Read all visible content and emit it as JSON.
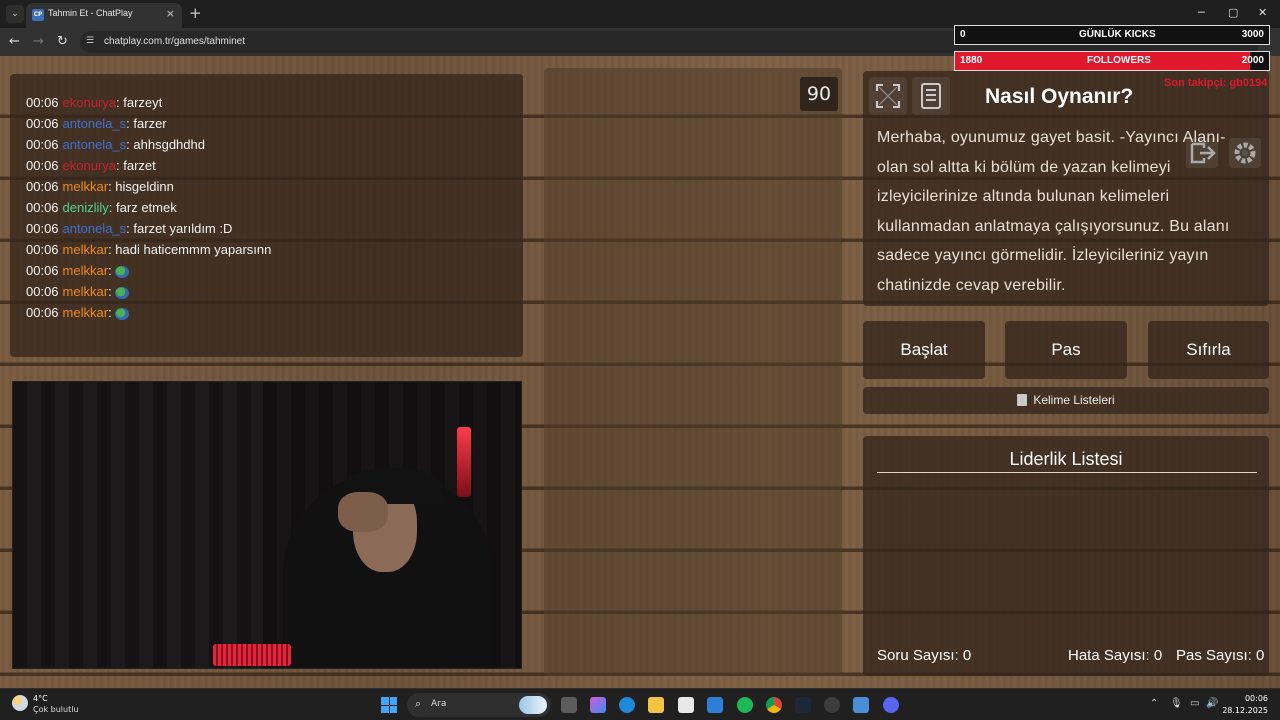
{
  "browser": {
    "tab_title": "Tahmin Et - ChatPlay",
    "tab_favicon_text": "CP",
    "url": "chatplay.com.tr/games/tahminet",
    "new_tab": "+",
    "close_tab": "×",
    "controls": {
      "minimize": "─",
      "maximize": "▢",
      "close": "✕"
    },
    "nav": {
      "back": "←",
      "forward": "→",
      "reload": "↻"
    }
  },
  "chat": {
    "messages": [
      {
        "time": "00:06",
        "user": "ekonurya",
        "user_color": "#c8202a",
        "text": "farzeyt"
      },
      {
        "time": "00:06",
        "user": "antonela_s",
        "user_color": "#3f6fd1",
        "text": "farzer"
      },
      {
        "time": "00:06",
        "user": "antonela_s",
        "user_color": "#3f6fd1",
        "text": "ahhsgdhdhd"
      },
      {
        "time": "00:06",
        "user": "ekonurya",
        "user_color": "#c8202a",
        "text": "farzet"
      },
      {
        "time": "00:06",
        "user": "melkkar",
        "user_color": "#f08a1c",
        "text": "hisgeldinn"
      },
      {
        "time": "00:06",
        "user": "denizlily",
        "user_color": "#4fd19a",
        "text": "farz etmek"
      },
      {
        "time": "00:06",
        "user": "antonela_s",
        "user_color": "#3f6fd1",
        "text": "farzet yarıldım :D"
      },
      {
        "time": "00:06",
        "user": "melkkar",
        "user_color": "#f08a1c",
        "text": "hadi haticemmm yaparsınn"
      },
      {
        "time": "00:06",
        "user": "melkkar",
        "user_color": "#f08a1c",
        "text": ""
      },
      {
        "time": "00:06",
        "user": "melkkar",
        "user_color": "#f08a1c",
        "text": ""
      },
      {
        "time": "00:06",
        "user": "melkkar",
        "user_color": "#f08a1c",
        "text": ""
      }
    ]
  },
  "game": {
    "timer": "90",
    "howto_title": "Nasıl Oynanır?",
    "howto_text": "Merhaba, oyunumuz gayet basit. -Yayıncı Alanı- olan sol altta ki bölüm de yazan kelimeyi izleyicilerinize altında bulunan kelimeleri kullanmadan anlatmaya çalışıyorsunuz. Bu alanı sadece yayıncı görmelidir. İzleyicileriniz yayın chatinizde cevap verebilir.",
    "buttons": {
      "start": "Başlat",
      "pass": "Pas",
      "reset": "Sıfırla"
    },
    "word_lists": "Kelime Listeleri",
    "leaderboard_title": "Liderlik Listesi",
    "stats": {
      "questions": "Soru Sayısı: 0",
      "errors": "Hata Sayısı: 0",
      "passes": "Pas Sayısı: 0"
    }
  },
  "overlay": {
    "kicks": {
      "current": "0",
      "label": "GÜNLÜK KICKS",
      "goal": "3000"
    },
    "followers": {
      "current": "1880",
      "label": "FOLLOWERS",
      "goal": "2000",
      "progress": 0.94
    },
    "sub_text": "Son takipçi: gb0194"
  },
  "taskbar": {
    "temp": "4°C",
    "weather": "Çok bulutlu",
    "search": "Ara",
    "time": "00:06",
    "date": "28.12.2025"
  },
  "colors": {
    "accent_red": "#e0182b",
    "text_light": "#f2f2f2"
  }
}
